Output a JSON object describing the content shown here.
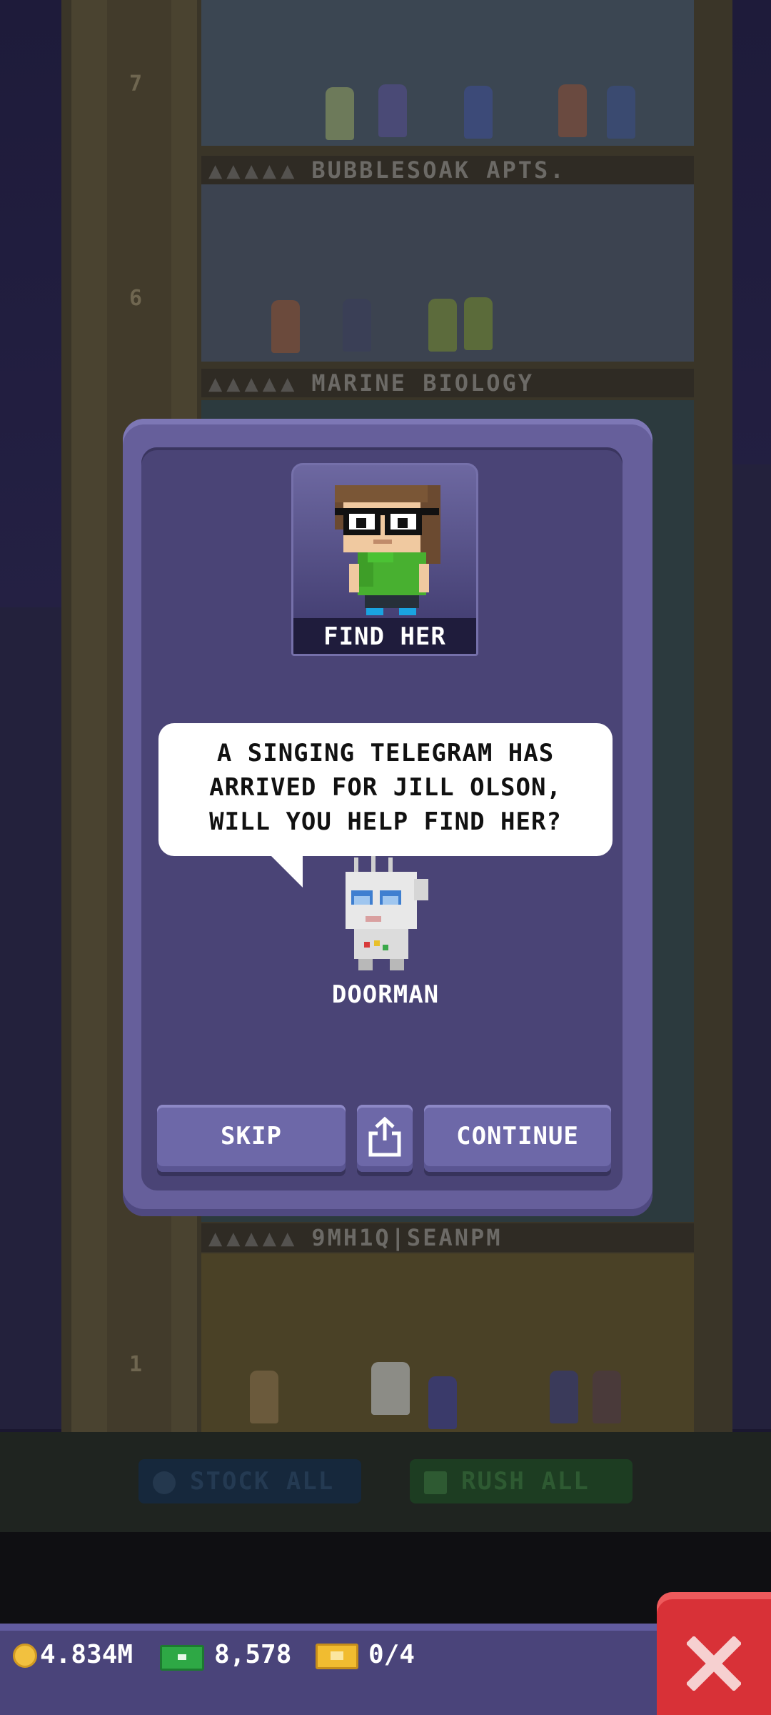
{
  "background": {
    "floors": [
      {
        "number": "7"
      },
      {
        "label": "BUBBLESOAK APTS.",
        "number": "6"
      },
      {
        "label": "MARINE BIOLOGY"
      },
      {
        "label": "9MH1Q|SEANPM",
        "number": "1"
      }
    ],
    "ground_buttons": {
      "stock_all": "STOCK ALL",
      "rush_all": "RUSH ALL"
    }
  },
  "dialog": {
    "portrait_caption": "FIND HER",
    "message": "A SINGING TELEGRAM HAS\nARRIVED FOR JILL OLSON,\nWILL YOU HELP FIND HER?",
    "speaker": "DOORMAN",
    "buttons": {
      "skip": "SKIP",
      "continue": "CONTINUE"
    }
  },
  "status_bar": {
    "coins": "4.834M",
    "tower_bux": "8,578",
    "vip_tickets": "0/4"
  },
  "colors": {
    "dialog_frame": "#665f9b",
    "dialog_panel": "#4a4476",
    "close_button": "#d83137",
    "coin": "#f2c13f",
    "bux": "#2ea845",
    "ticket": "#f1bc30"
  },
  "icons": [
    "coin-icon",
    "tower-bux-icon",
    "vip-ticket-icon",
    "share-icon",
    "close-icon",
    "stock-icon",
    "rush-icon"
  ]
}
